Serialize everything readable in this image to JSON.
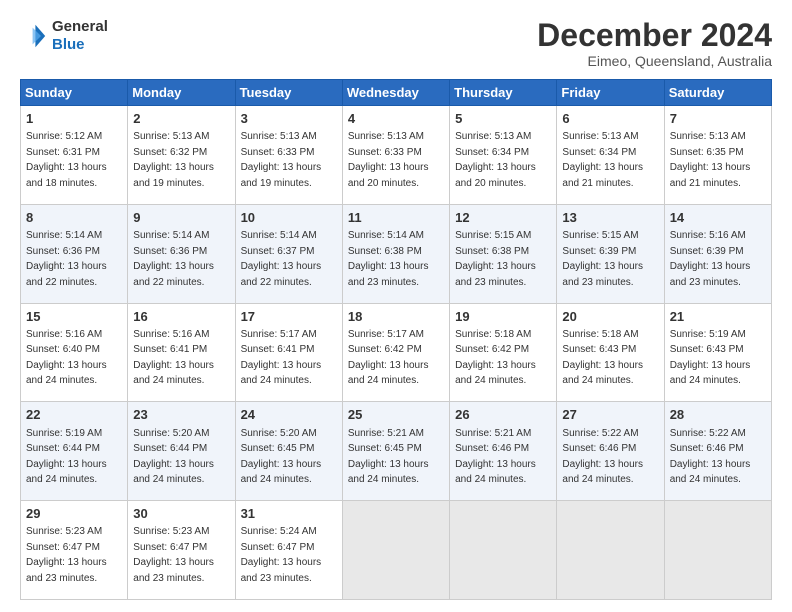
{
  "header": {
    "logo_line1": "General",
    "logo_line2": "Blue",
    "title": "December 2024",
    "subtitle": "Eimeo, Queensland, Australia"
  },
  "calendar": {
    "days_of_week": [
      "Sunday",
      "Monday",
      "Tuesday",
      "Wednesday",
      "Thursday",
      "Friday",
      "Saturday"
    ],
    "weeks": [
      [
        null,
        null,
        {
          "day": "3",
          "sunrise": "5:13 AM",
          "sunset": "6:33 PM",
          "daylight": "13 hours and 19 minutes."
        },
        {
          "day": "4",
          "sunrise": "5:13 AM",
          "sunset": "6:33 PM",
          "daylight": "13 hours and 20 minutes."
        },
        {
          "day": "5",
          "sunrise": "5:13 AM",
          "sunset": "6:34 PM",
          "daylight": "13 hours and 20 minutes."
        },
        {
          "day": "6",
          "sunrise": "5:13 AM",
          "sunset": "6:34 PM",
          "daylight": "13 hours and 21 minutes."
        },
        {
          "day": "7",
          "sunrise": "5:13 AM",
          "sunset": "6:35 PM",
          "daylight": "13 hours and 21 minutes."
        }
      ],
      [
        {
          "day": "1",
          "sunrise": "5:12 AM",
          "sunset": "6:31 PM",
          "daylight": "13 hours and 18 minutes."
        },
        {
          "day": "2",
          "sunrise": "5:13 AM",
          "sunset": "6:32 PM",
          "daylight": "13 hours and 19 minutes."
        },
        null,
        null,
        null,
        null,
        null
      ],
      [
        {
          "day": "8",
          "sunrise": "5:14 AM",
          "sunset": "6:36 PM",
          "daylight": "13 hours and 22 minutes."
        },
        {
          "day": "9",
          "sunrise": "5:14 AM",
          "sunset": "6:36 PM",
          "daylight": "13 hours and 22 minutes."
        },
        {
          "day": "10",
          "sunrise": "5:14 AM",
          "sunset": "6:37 PM",
          "daylight": "13 hours and 22 minutes."
        },
        {
          "day": "11",
          "sunrise": "5:14 AM",
          "sunset": "6:38 PM",
          "daylight": "13 hours and 23 minutes."
        },
        {
          "day": "12",
          "sunrise": "5:15 AM",
          "sunset": "6:38 PM",
          "daylight": "13 hours and 23 minutes."
        },
        {
          "day": "13",
          "sunrise": "5:15 AM",
          "sunset": "6:39 PM",
          "daylight": "13 hours and 23 minutes."
        },
        {
          "day": "14",
          "sunrise": "5:16 AM",
          "sunset": "6:39 PM",
          "daylight": "13 hours and 23 minutes."
        }
      ],
      [
        {
          "day": "15",
          "sunrise": "5:16 AM",
          "sunset": "6:40 PM",
          "daylight": "13 hours and 24 minutes."
        },
        {
          "day": "16",
          "sunrise": "5:16 AM",
          "sunset": "6:41 PM",
          "daylight": "13 hours and 24 minutes."
        },
        {
          "day": "17",
          "sunrise": "5:17 AM",
          "sunset": "6:41 PM",
          "daylight": "13 hours and 24 minutes."
        },
        {
          "day": "18",
          "sunrise": "5:17 AM",
          "sunset": "6:42 PM",
          "daylight": "13 hours and 24 minutes."
        },
        {
          "day": "19",
          "sunrise": "5:18 AM",
          "sunset": "6:42 PM",
          "daylight": "13 hours and 24 minutes."
        },
        {
          "day": "20",
          "sunrise": "5:18 AM",
          "sunset": "6:43 PM",
          "daylight": "13 hours and 24 minutes."
        },
        {
          "day": "21",
          "sunrise": "5:19 AM",
          "sunset": "6:43 PM",
          "daylight": "13 hours and 24 minutes."
        }
      ],
      [
        {
          "day": "22",
          "sunrise": "5:19 AM",
          "sunset": "6:44 PM",
          "daylight": "13 hours and 24 minutes."
        },
        {
          "day": "23",
          "sunrise": "5:20 AM",
          "sunset": "6:44 PM",
          "daylight": "13 hours and 24 minutes."
        },
        {
          "day": "24",
          "sunrise": "5:20 AM",
          "sunset": "6:45 PM",
          "daylight": "13 hours and 24 minutes."
        },
        {
          "day": "25",
          "sunrise": "5:21 AM",
          "sunset": "6:45 PM",
          "daylight": "13 hours and 24 minutes."
        },
        {
          "day": "26",
          "sunrise": "5:21 AM",
          "sunset": "6:46 PM",
          "daylight": "13 hours and 24 minutes."
        },
        {
          "day": "27",
          "sunrise": "5:22 AM",
          "sunset": "6:46 PM",
          "daylight": "13 hours and 24 minutes."
        },
        {
          "day": "28",
          "sunrise": "5:22 AM",
          "sunset": "6:46 PM",
          "daylight": "13 hours and 24 minutes."
        }
      ],
      [
        {
          "day": "29",
          "sunrise": "5:23 AM",
          "sunset": "6:47 PM",
          "daylight": "13 hours and 23 minutes."
        },
        {
          "day": "30",
          "sunrise": "5:23 AM",
          "sunset": "6:47 PM",
          "daylight": "13 hours and 23 minutes."
        },
        {
          "day": "31",
          "sunrise": "5:24 AM",
          "sunset": "6:47 PM",
          "daylight": "13 hours and 23 minutes."
        },
        null,
        null,
        null,
        null
      ]
    ]
  }
}
